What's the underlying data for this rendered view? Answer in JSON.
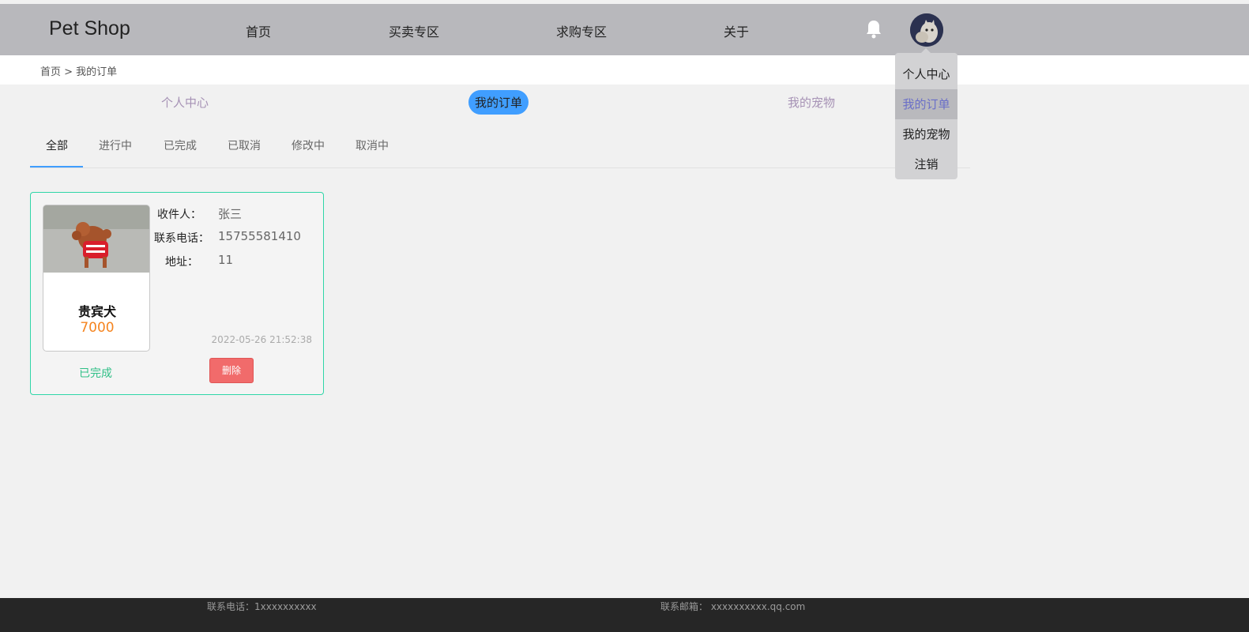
{
  "header": {
    "logo": "Pet Shop",
    "nav": [
      "首页",
      "买卖专区",
      "求购专区",
      "关于"
    ]
  },
  "user_menu": {
    "items": [
      "个人中心",
      "我的订单",
      "我的宠物",
      "注销"
    ],
    "active_index": 1
  },
  "breadcrumb": "首页 > 我的订单",
  "main_tabs": [
    "个人中心",
    "我的订单",
    "我的宠物"
  ],
  "order_tabs": [
    "全部",
    "进行中",
    "已完成",
    "已取消",
    "修改中",
    "取消中"
  ],
  "order": {
    "pet_name": "贵宾犬",
    "price": "7000",
    "recipient_label": "收件人：",
    "recipient": "张三",
    "phone_label": "联系电话：",
    "phone": "15755581410",
    "address_label": "地址：",
    "address": "11",
    "time": "2022-05-26 21:52:38",
    "status": "已完成",
    "delete_label": "删除"
  },
  "footer": {
    "phone": "联系电话：1xxxxxxxxxx",
    "email": "联系邮箱： xxxxxxxxxx.qq.com"
  },
  "colors": {
    "accent": "#409eff",
    "card_border": "#2fd6a8",
    "price": "#f5841f",
    "status_done": "#2fbf86",
    "delete": "#f16b6b"
  },
  "icons": [
    "bell-icon",
    "avatar"
  ]
}
